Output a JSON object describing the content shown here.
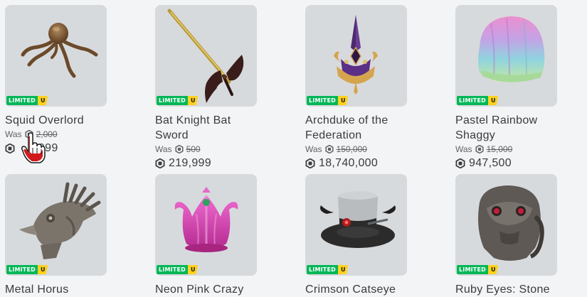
{
  "items": [
    {
      "name": "Squid Overlord",
      "badge_limited": "LIMITED",
      "badge_u": "U",
      "was_label": "Was",
      "was_price": "2,000",
      "price": "8,999",
      "icon": "squid-hat-image"
    },
    {
      "name": "Bat Knight Bat Sword",
      "badge_limited": "LIMITED",
      "badge_u": "U",
      "was_label": "",
      "was_price": "",
      "price": "",
      "icon": "bat-sword-image"
    },
    {
      "name": "Archduke of the Federation",
      "badge_limited": "LIMITED",
      "badge_u": "U",
      "was_label": "Was",
      "was_price": "150,000",
      "price": "18,740,000",
      "icon": "crown-image"
    },
    {
      "name": "Pastel Rainbow Shaggy",
      "badge_limited": "LIMITED",
      "badge_u": "U",
      "was_label": "Was",
      "was_price": "15,000",
      "price": "947,500",
      "icon": "rainbow-hair-image"
    },
    {
      "name": "Metal Horus",
      "badge_limited": "LIMITED",
      "badge_u": "U",
      "icon": "metal-horus-image"
    },
    {
      "name": "Neon Pink Crazy",
      "badge_limited": "LIMITED",
      "badge_u": "U",
      "icon": "neon-pink-crown-image"
    },
    {
      "name": "Crimson Catseye",
      "badge_limited": "LIMITED",
      "badge_u": "U",
      "icon": "top-hat-image"
    },
    {
      "name": "Ruby Eyes: Stone",
      "badge_limited": "LIMITED",
      "badge_u": "U",
      "icon": "ruby-eyes-image"
    }
  ],
  "item2": {
    "was_label": "Was",
    "was_price": "500",
    "price": "219,999"
  },
  "colors": {
    "limited_green": "#02b757",
    "u_yellow": "#ffd21f",
    "thumb_bg": "#d7dadd",
    "page_bg": "#f2f4f5"
  }
}
